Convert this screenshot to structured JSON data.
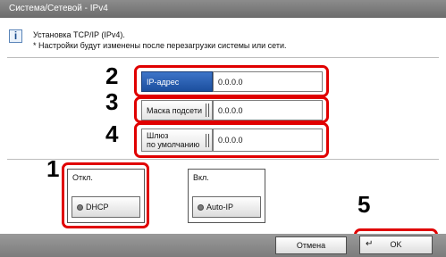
{
  "window": {
    "title": "Система/Сетевой - IPv4"
  },
  "info": {
    "icon": "info-icon",
    "line1": "Установка TCP/IP (IPv4).",
    "line2": "* Настройки будут изменены после перезагрузки системы или сети."
  },
  "steps": [
    "1",
    "2",
    "3",
    "4",
    "5"
  ],
  "fields": {
    "ip": {
      "label": "IP-адрес",
      "value": "0.0.0.0"
    },
    "mask": {
      "label": "Маска подсети",
      "value": "0.0.0.0"
    },
    "gateway": {
      "label_line1": "Шлюз",
      "label_line2": "по умолчанию",
      "value": "0.0.0.0"
    }
  },
  "groups": {
    "off": {
      "caption": "Откл.",
      "button": "DHCP"
    },
    "on": {
      "caption": "Вкл.",
      "button": "Auto-IP"
    }
  },
  "footer": {
    "cancel": "Отмена",
    "ok": "OK",
    "ok_icon": "return-arrow-icon"
  },
  "colors": {
    "highlight": "#e00000",
    "selected": "#2a5fb0",
    "titlebar": "#7a7a7a"
  }
}
